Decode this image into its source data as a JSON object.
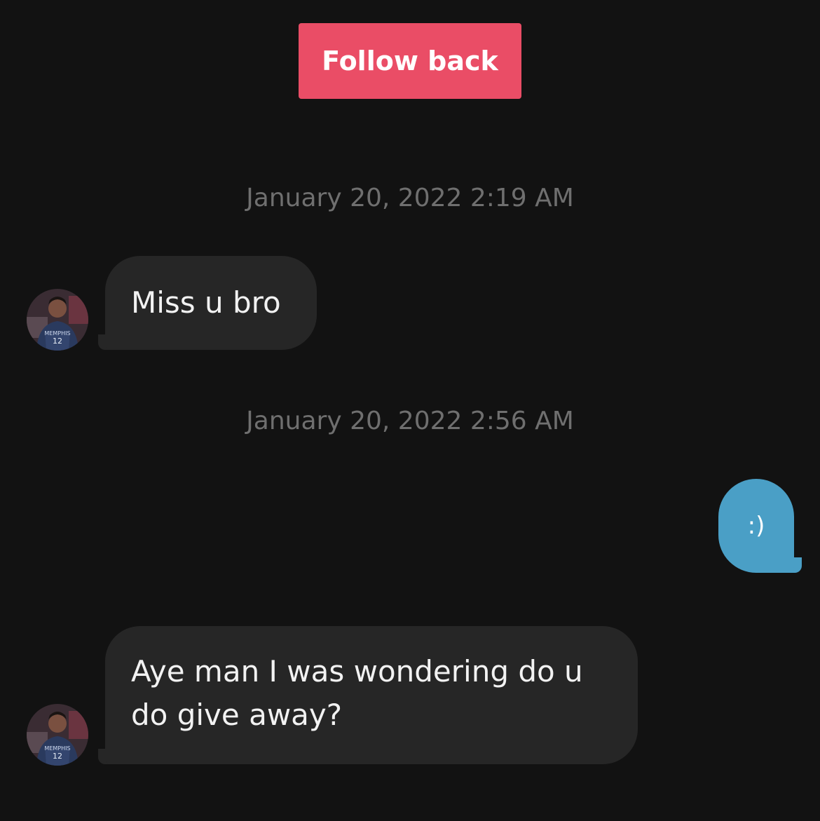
{
  "header": {
    "follow_back_label": "Follow back"
  },
  "messages": [
    {
      "timestamp": "January 20, 2022 2:19 AM",
      "sender": "other",
      "text": "Miss u bro"
    },
    {
      "timestamp": "January 20, 2022 2:56 AM",
      "sender": "me",
      "text": ":)"
    },
    {
      "sender": "other",
      "text": "Aye man I was wondering do u do give away?"
    }
  ],
  "avatar": {
    "jersey_text": "MEMPHIS",
    "jersey_number": "12"
  },
  "colors": {
    "background": "#121212",
    "follow_button": "#ea4d66",
    "incoming_bubble": "#262626",
    "outgoing_bubble": "#4a9fc6",
    "timestamp": "#6f6f6f"
  }
}
